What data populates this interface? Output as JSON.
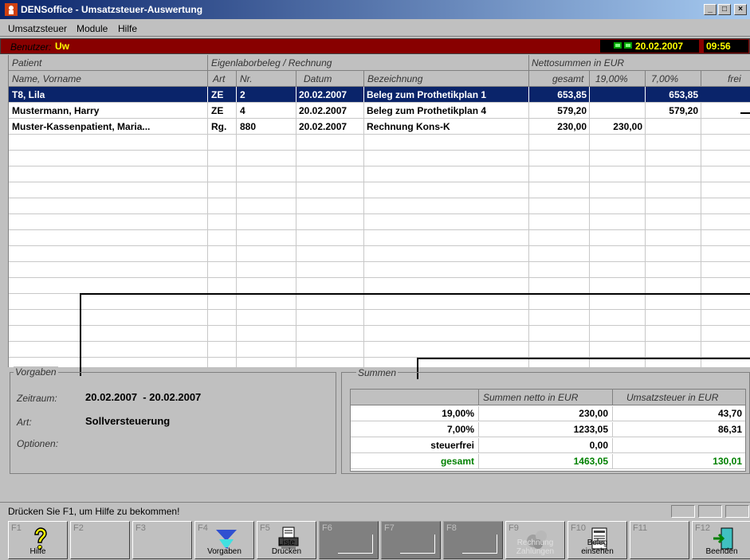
{
  "window": {
    "title": "DENSoffice - Umsatzsteuer-Auswertung",
    "btn_min": "_",
    "btn_max": "□",
    "btn_close": "×"
  },
  "menu": [
    "Umsatzsteuer",
    "Module",
    "Hilfe"
  ],
  "userbar": {
    "label": "Benutzer:",
    "user": "Uw",
    "date": "20.02.2007",
    "time": "09:56"
  },
  "grid": {
    "group_headers": [
      "Patient",
      "Eigenlaborbeleg / Rechnung",
      "Nettosummen in EUR"
    ],
    "columns": [
      "Name, Vorname",
      "Art",
      "Nr.",
      "Datum",
      "Bezeichnung",
      "gesamt",
      "19,00%",
      "7,00%",
      "frei"
    ],
    "rows": [
      {
        "name": "T8, Lila",
        "art": "ZE",
        "nr": "2",
        "datum": "20.02.2007",
        "bez": "Beleg zum Prothetikplan 1",
        "gesamt": "653,85",
        "p19": "",
        "p7": "653,85",
        "frei": "",
        "selected": true
      },
      {
        "name": "Mustermann, Harry",
        "art": "ZE",
        "nr": "4",
        "datum": "20.02.2007",
        "bez": "Beleg zum Prothetikplan 4",
        "gesamt": "579,20",
        "p19": "",
        "p7": "579,20",
        "frei": "",
        "selected": false
      },
      {
        "name": "Muster-Kassenpatient, Maria...",
        "art": "Rg.",
        "nr": "880",
        "datum": "20.02.2007",
        "bez": "Rechnung Kons-K",
        "gesamt": "230,00",
        "p19": "230,00",
        "p7": "",
        "frei": "",
        "selected": false
      }
    ]
  },
  "vorgaben": {
    "title": "Vorgaben",
    "zeitraum_label": "Zeitraum:",
    "zeitraum_value": "20.02.2007  - 20.02.2007",
    "art_label": "Art:",
    "art_value": "Sollversteuerung",
    "optionen_label": "Optionen:"
  },
  "summen": {
    "title": "Summen",
    "col_netto": "Summen netto in EUR",
    "col_ust": "Umsatzsteuer in EUR",
    "rows": [
      {
        "label": "19,00%",
        "netto": "230,00",
        "ust": "43,70"
      },
      {
        "label": "7,00%",
        "netto": "1233,05",
        "ust": "86,31"
      },
      {
        "label": "steuerfrei",
        "netto": "0,00",
        "ust": ""
      },
      {
        "label": "gesamt",
        "netto": "1463,05",
        "ust": "130,01"
      }
    ]
  },
  "status": {
    "text": "Drücken Sie F1, um Hilfe zu bekommen!"
  },
  "fkeys": [
    {
      "key": "F1",
      "label": "Hilfe",
      "icon": "help-icon"
    },
    {
      "key": "F2",
      "label": ""
    },
    {
      "key": "F3",
      "label": ""
    },
    {
      "key": "F4",
      "label": "Vorgaben",
      "icon": "filter-icon"
    },
    {
      "key": "F5",
      "label": "Liste\nDrucken",
      "icon": "printer-icon"
    },
    {
      "key": "F6",
      "label": ""
    },
    {
      "key": "F7",
      "label": ""
    },
    {
      "key": "F8",
      "label": ""
    },
    {
      "key": "F9",
      "label": "Rechnung\nZahlungen",
      "icon": "payment-icon"
    },
    {
      "key": "F10",
      "label": "Beleg\neinsehen",
      "icon": "document-icon"
    },
    {
      "key": "F11",
      "label": ""
    },
    {
      "key": "F12",
      "label": "Beenden",
      "icon": "exit-icon"
    }
  ],
  "colors": {
    "selection": "#0a246a",
    "userbar": "#880000",
    "highlight_text": "#ffff00",
    "total_green": "#008000"
  }
}
